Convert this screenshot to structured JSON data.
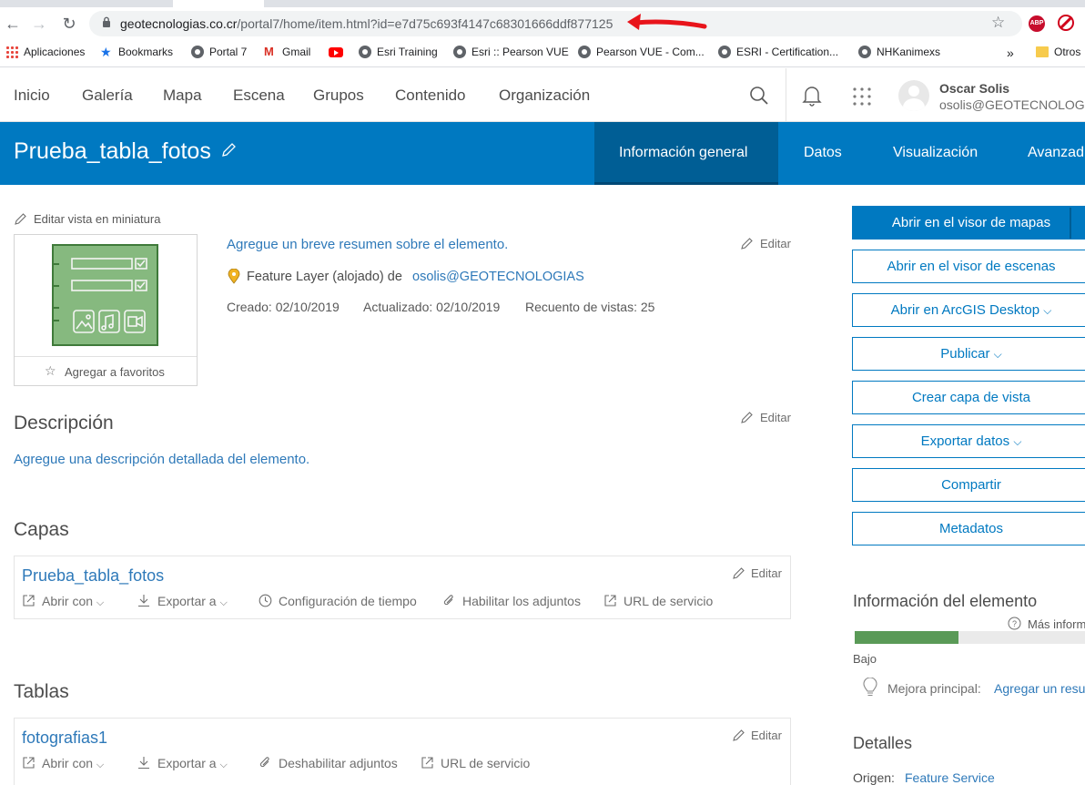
{
  "browser": {
    "url_host": "geotecnologias.co.cr",
    "url_path": "/portal7/home/item.html?id=e7d75c693f4147c68301666ddf877125",
    "bookmarks": [
      {
        "label": "Aplicaciones",
        "icon": "apps-grid-icon"
      },
      {
        "label": "Bookmarks",
        "icon": "star-icon"
      },
      {
        "label": "Portal 7",
        "icon": "globe-icon"
      },
      {
        "label": "Gmail",
        "icon": "gmail-icon"
      },
      {
        "label": "",
        "icon": "youtube-icon"
      },
      {
        "label": "Esri Training",
        "icon": "globe-icon"
      },
      {
        "label": "Esri :: Pearson VUE",
        "icon": "globe-icon"
      },
      {
        "label": "Pearson VUE - Com...",
        "icon": "globe-icon"
      },
      {
        "label": "ESRI - Certification...",
        "icon": "globe-icon"
      },
      {
        "label": "NHKanimexs",
        "icon": "globe-icon"
      },
      {
        "label": "»",
        "icon": ""
      },
      {
        "label": "Otros",
        "icon": "folder-icon"
      }
    ],
    "extensions": {
      "abp": "ABP"
    }
  },
  "header": {
    "nav": [
      "Inicio",
      "Galería",
      "Mapa",
      "Escena",
      "Grupos",
      "Contenido",
      "Organización"
    ],
    "user_name": "Oscar Solis",
    "user_email": "osolis@GEOTECNOLOG..."
  },
  "item_bar": {
    "title": "Prueba_tabla_fotos",
    "tabs": [
      "Información general",
      "Datos",
      "Visualización",
      "Avanzad"
    ],
    "active_tab": 0
  },
  "overview": {
    "edit_thumbnail": "Editar vista en miniatura",
    "add_favorite": "Agregar a favoritos",
    "summary_prompt": "Agregue un breve resumen sobre el elemento.",
    "edit": "Editar",
    "type_text": "Feature Layer (alojado) de",
    "owner": "osolis@GEOTECNOLOGIAS",
    "created": "Creado: 02/10/2019",
    "updated": "Actualizado: 02/10/2019",
    "views": "Recuento de vistas: 25"
  },
  "description": {
    "heading": "Descripción",
    "prompt": "Agregue una descripción detallada del elemento."
  },
  "layers": {
    "heading": "Capas",
    "items": [
      {
        "name": "Prueba_tabla_fotos",
        "actions": [
          "Abrir con",
          "Exportar a",
          "Configuración de tiempo",
          "Habilitar los adjuntos",
          "URL de servicio"
        ]
      }
    ]
  },
  "tables": {
    "heading": "Tablas",
    "items": [
      {
        "name": "fotografias1",
        "actions": [
          "Abrir con",
          "Exportar a",
          "Deshabilitar adjuntos",
          "URL de servicio"
        ]
      }
    ]
  },
  "sidebar": {
    "buttons": [
      "Abrir en el visor de mapas",
      "Abrir en el visor de escenas",
      "Abrir en ArcGIS Desktop",
      "Publicar",
      "Crear capa de vista",
      "Exportar datos",
      "Compartir",
      "Metadatos"
    ],
    "item_info_heading": "Información del elemento",
    "more_info": "Más inform",
    "quality_level": "Bajo",
    "quality_fraction": 0.44,
    "quality_color": "#5a9a57",
    "top_improvement_label": "Mejora principal:",
    "top_improvement_link": "Agregar un resu",
    "details_heading": "Detalles",
    "source_label": "Origen:",
    "source_value": "Feature Service"
  },
  "colors": {
    "brand_blue": "#0079c1",
    "active_tab": "#005e95",
    "link": "#2e79b9",
    "annotation_arrow": "#e8141b"
  }
}
